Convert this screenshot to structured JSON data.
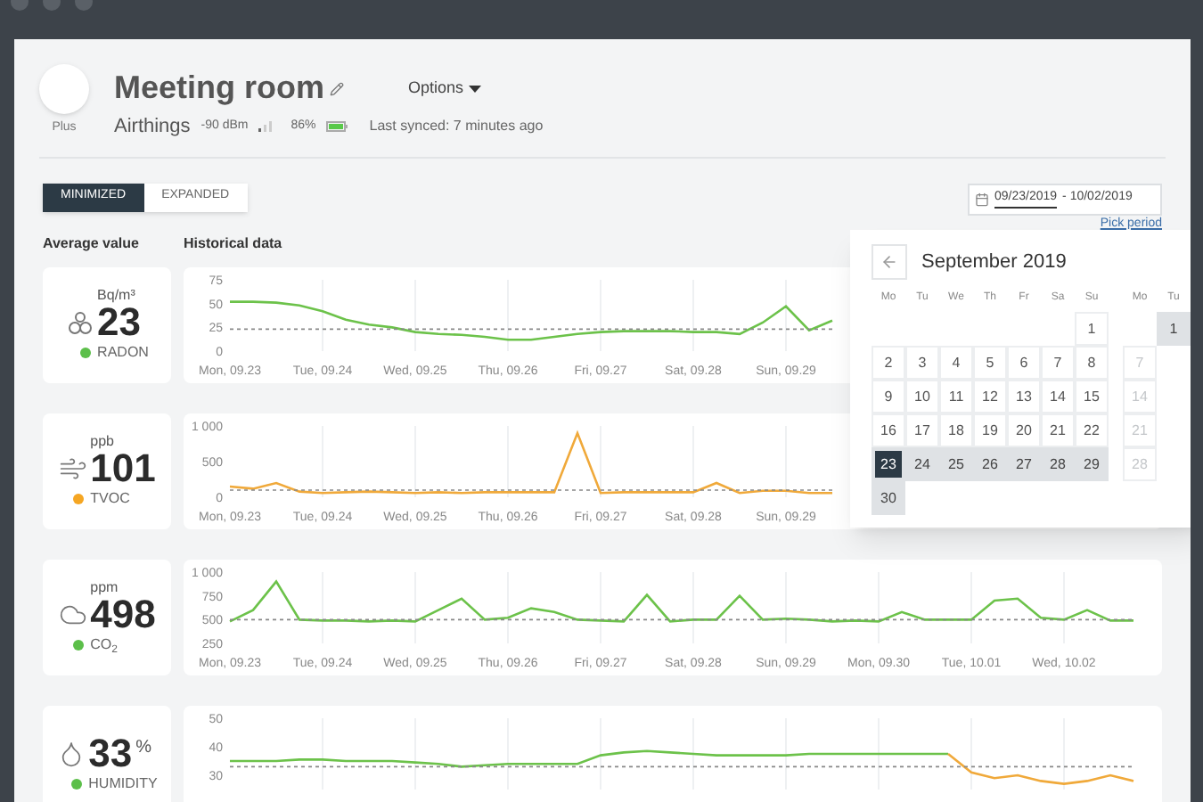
{
  "header": {
    "device_model": "Plus",
    "title": "Meeting room",
    "options_label": "Options",
    "brand": "Airthings",
    "signal": "-90 dBm",
    "battery": "86%",
    "last_synced": "Last synced: 7 minutes ago"
  },
  "view_tabs": [
    {
      "label": "MINIMIZED",
      "selected": true
    },
    {
      "label": "EXPANDED",
      "selected": false
    }
  ],
  "date_range": {
    "start": "09/23/2019",
    "end": "- 10/02/2019",
    "pick_period": "Pick period"
  },
  "column_headings": [
    "Average value",
    "Historical data"
  ],
  "metrics": [
    {
      "kind": "radon",
      "unit_above": true,
      "unit": "Bq/m³",
      "value": "23",
      "label": "RADON",
      "color": "#5cbf4a",
      "chart_data": {
        "type": "line",
        "grid": true,
        "categories": [
          "Mon, 09.23",
          null,
          null,
          null,
          "Tue, 09.24",
          null,
          null,
          null,
          "Wed, 09.25",
          null,
          null,
          null,
          "Thu, 09.26",
          null,
          null,
          null,
          "Fri, 09.27",
          null,
          null,
          null,
          "Sat, 09.28",
          null,
          null,
          null,
          "Sun, 09.29",
          null,
          null,
          null,
          null,
          null,
          null,
          null,
          null,
          null,
          null,
          null,
          null,
          null,
          null,
          null
        ],
        "ylim": [
          0,
          75
        ],
        "yticks": [
          0,
          25,
          50,
          75
        ],
        "series": [
          {
            "line_style": "solid",
            "color": "#6cc24a",
            "values": [
              52,
              52,
              51,
              48,
              42,
              33,
              28,
              25,
              20,
              18,
              17,
              15,
              12,
              12,
              15,
              18,
              20,
              21,
              21,
              21,
              20,
              20,
              18,
              30,
              47,
              22,
              32,
              null,
              null,
              null,
              null,
              null,
              null,
              null,
              null,
              null,
              null,
              null,
              null,
              null
            ]
          },
          {
            "line_style": "dashed",
            "color": "#888888",
            "values": [
              23,
              23,
              23,
              23,
              23,
              23,
              23,
              23,
              23,
              23,
              23,
              23,
              23,
              23,
              23,
              23,
              23,
              23,
              23,
              23,
              23,
              23,
              23,
              23,
              23,
              23,
              23,
              null,
              null,
              null,
              null,
              null,
              null,
              null,
              null,
              null,
              null,
              null,
              null,
              null
            ]
          }
        ]
      }
    },
    {
      "kind": "tvoc",
      "unit_above": true,
      "unit": "ppb",
      "value": "101",
      "label": "TVOC",
      "color": "#f5a623",
      "chart_data": {
        "type": "line",
        "grid": true,
        "categories": [
          "Mon, 09.23",
          null,
          null,
          null,
          "Tue, 09.24",
          null,
          null,
          null,
          "Wed, 09.25",
          null,
          null,
          null,
          "Thu, 09.26",
          null,
          null,
          null,
          "Fri, 09.27",
          null,
          null,
          null,
          "Sat, 09.28",
          null,
          null,
          null,
          "Sun, 09.29",
          null,
          null,
          null,
          null,
          null,
          null,
          null,
          null,
          null,
          null,
          null,
          null,
          null,
          null,
          null
        ],
        "ylim": [
          0,
          1000
        ],
        "yticks": [
          0,
          500,
          {
            "value": 1000,
            "label": "1 000"
          }
        ],
        "series": [
          {
            "line_style": "solid",
            "color": "#f0a93a",
            "values": [
              150,
              120,
              200,
              80,
              60,
              70,
              80,
              70,
              60,
              70,
              60,
              70,
              70,
              70,
              70,
              900,
              60,
              70,
              70,
              70,
              70,
              200,
              60,
              90,
              90,
              60,
              60,
              null,
              null,
              null,
              null,
              null,
              null,
              null,
              null,
              null,
              null,
              null,
              null,
              null
            ]
          },
          {
            "line_style": "dashed",
            "color": "#888888",
            "values": [
              100,
              100,
              100,
              100,
              100,
              100,
              100,
              100,
              100,
              100,
              100,
              100,
              100,
              100,
              100,
              100,
              100,
              100,
              100,
              100,
              100,
              100,
              100,
              100,
              100,
              100,
              100,
              null,
              null,
              null,
              null,
              null,
              null,
              null,
              null,
              null,
              null,
              null,
              null,
              null
            ]
          }
        ]
      }
    },
    {
      "kind": "co2",
      "unit_above": true,
      "unit": "ppm",
      "value": "498",
      "label": "CO$_{2}$",
      "color": "#5cbf4a",
      "chart_data": {
        "type": "line",
        "grid": true,
        "categories": [
          "Mon, 09.23",
          null,
          null,
          null,
          "Tue, 09.24",
          null,
          null,
          null,
          "Wed, 09.25",
          null,
          null,
          null,
          "Thu, 09.26",
          null,
          null,
          null,
          "Fri, 09.27",
          null,
          null,
          null,
          "Sat, 09.28",
          null,
          null,
          null,
          "Sun, 09.29",
          null,
          null,
          null,
          "Mon, 09.30",
          null,
          null,
          null,
          "Tue, 10.01",
          null,
          null,
          null,
          "Wed, 10.02",
          null,
          null,
          null
        ],
        "ylim": [
          250,
          1000
        ],
        "yticks": [
          250,
          500,
          750,
          {
            "value": 1000,
            "label": "1 000"
          }
        ],
        "series": [
          {
            "line_style": "solid",
            "color": "#6cc24a",
            "values": [
              480,
              600,
              900,
              500,
              490,
              490,
              480,
              490,
              480,
              600,
              720,
              500,
              520,
              620,
              580,
              500,
              490,
              480,
              760,
              480,
              500,
              500,
              750,
              500,
              510,
              500,
              480,
              490,
              480,
              580,
              500,
              500,
              500,
              700,
              720,
              520,
              500,
              600,
              490,
              490
            ]
          },
          {
            "line_style": "dashed",
            "color": "#888888",
            "values": [
              500,
              500,
              500,
              500,
              500,
              500,
              500,
              500,
              500,
              500,
              500,
              500,
              500,
              500,
              500,
              500,
              500,
              500,
              500,
              500,
              500,
              500,
              500,
              500,
              500,
              500,
              500,
              500,
              500,
              500,
              500,
              500,
              500,
              500,
              500,
              500,
              500,
              500,
              500,
              500
            ]
          }
        ]
      }
    },
    {
      "kind": "humidity",
      "unit_above": false,
      "unit": "%",
      "value": "33",
      "label": "HUMIDITY",
      "color": "#5cbf4a",
      "chart_data": {
        "type": "line",
        "grid": true,
        "categories": [
          null,
          null,
          null,
          null,
          null,
          null,
          null,
          null,
          null,
          null,
          null,
          null,
          null,
          null,
          null,
          null,
          null,
          null,
          null,
          null,
          null,
          null,
          null,
          null,
          null,
          null,
          null,
          null,
          null,
          null,
          null,
          null,
          null,
          null,
          null,
          null,
          null,
          null,
          null,
          null
        ],
        "ylim": [
          25,
          50
        ],
        "yticks": [
          30,
          40,
          50
        ],
        "series": [
          {
            "line_style": "solid",
            "color": "#6cc24a",
            "values": [
              35,
              35,
              35,
              35.5,
              35.5,
              35,
              35,
              35,
              34.5,
              34,
              33,
              33.5,
              34,
              34,
              34,
              34,
              37,
              38,
              38.5,
              38,
              37.5,
              37,
              37,
              37,
              37,
              37.5,
              37.5,
              37.5,
              37.5,
              37.5,
              37.5,
              37.5,
              null,
              null,
              null,
              null,
              null,
              null,
              null,
              null
            ]
          },
          {
            "line_style": "solid",
            "color": "#f0a93a",
            "values": [
              null,
              null,
              null,
              null,
              null,
              null,
              null,
              null,
              null,
              null,
              null,
              null,
              null,
              null,
              null,
              null,
              null,
              null,
              null,
              null,
              null,
              null,
              null,
              null,
              null,
              null,
              null,
              null,
              null,
              null,
              null,
              37.5,
              31,
              29,
              30,
              28,
              27,
              28,
              30,
              28
            ]
          },
          {
            "line_style": "dashed",
            "color": "#888888",
            "values": [
              33,
              33,
              33,
              33,
              33,
              33,
              33,
              33,
              33,
              33,
              33,
              33,
              33,
              33,
              33,
              33,
              33,
              33,
              33,
              33,
              33,
              33,
              33,
              33,
              33,
              33,
              33,
              33,
              33,
              33,
              33,
              33,
              33,
              33,
              33,
              33,
              33,
              33,
              33,
              33
            ]
          }
        ]
      }
    }
  ],
  "calendar": {
    "month_title": "September 2019",
    "weekdays": [
      "Mo",
      "Tu",
      "We",
      "Th",
      "Fr",
      "Sa",
      "Su"
    ],
    "weeks": [
      {
        "align_right": true,
        "days": [
          {
            "day": "1",
            "selected": false,
            "in_range": false
          }
        ]
      },
      {
        "days": [
          {
            "day": "2",
            "selected": false,
            "in_range": false
          },
          {
            "day": "3",
            "selected": false,
            "in_range": false
          },
          {
            "day": "4",
            "selected": false,
            "in_range": false
          },
          {
            "day": "5",
            "selected": false,
            "in_range": false
          },
          {
            "day": "6",
            "selected": false,
            "in_range": false
          },
          {
            "day": "7",
            "selected": false,
            "in_range": false
          },
          {
            "day": "8",
            "selected": false,
            "in_range": false
          }
        ]
      },
      {
        "days": [
          {
            "day": "9",
            "selected": false,
            "in_range": false
          },
          {
            "day": "10",
            "selected": false,
            "in_range": false
          },
          {
            "day": "11",
            "selected": false,
            "in_range": false
          },
          {
            "day": "12",
            "selected": false,
            "in_range": false
          },
          {
            "day": "13",
            "selected": false,
            "in_range": false
          },
          {
            "day": "14",
            "selected": false,
            "in_range": false
          },
          {
            "day": "15",
            "selected": false,
            "in_range": false
          }
        ]
      },
      {
        "days": [
          {
            "day": "16",
            "selected": false,
            "in_range": false
          },
          {
            "day": "17",
            "selected": false,
            "in_range": false
          },
          {
            "day": "18",
            "selected": false,
            "in_range": false
          },
          {
            "day": "19",
            "selected": false,
            "in_range": false
          },
          {
            "day": "20",
            "selected": false,
            "in_range": false
          },
          {
            "day": "21",
            "selected": false,
            "in_range": false
          },
          {
            "day": "22",
            "selected": false,
            "in_range": false
          }
        ]
      },
      {
        "days": [
          {
            "day": "23",
            "selected": true,
            "in_range": true
          },
          {
            "day": "24",
            "selected": false,
            "in_range": true
          },
          {
            "day": "25",
            "selected": false,
            "in_range": true
          },
          {
            "day": "26",
            "selected": false,
            "in_range": true
          },
          {
            "day": "27",
            "selected": false,
            "in_range": true
          },
          {
            "day": "28",
            "selected": false,
            "in_range": true
          },
          {
            "day": "29",
            "selected": false,
            "in_range": true
          }
        ]
      },
      {
        "days": [
          {
            "day": "30",
            "selected": false,
            "in_range": true
          }
        ]
      }
    ],
    "next_month": {
      "weekdays": [
        "Mo",
        "Tu"
      ],
      "weeks": [
        {
          "align_right": true,
          "days": [
            {
              "day": "1",
              "selected": false,
              "in_range": true
            }
          ]
        },
        {
          "days": [
            {
              "day": "7",
              "selected": false,
              "in_range": false
            }
          ]
        },
        {
          "days": [
            {
              "day": "14",
              "selected": false,
              "in_range": false
            }
          ]
        },
        {
          "days": [
            {
              "day": "21",
              "selected": false,
              "in_range": false
            }
          ]
        },
        {
          "days": [
            {
              "day": "28",
              "selected": false,
              "in_range": false
            }
          ]
        }
      ]
    }
  }
}
